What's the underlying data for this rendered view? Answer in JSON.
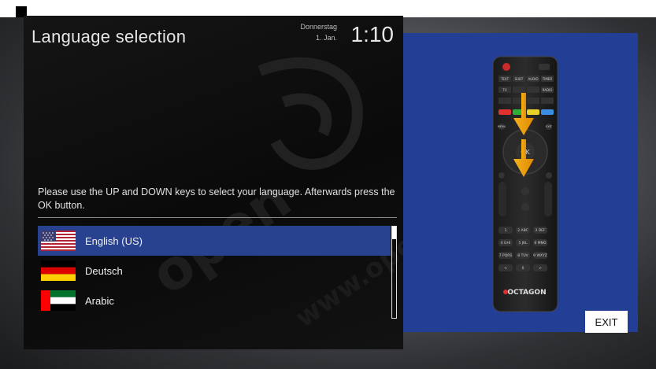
{
  "window": {
    "title": "Language selection",
    "day": "Donnerstag",
    "date": "1. Jan.",
    "time": "1:10"
  },
  "instructions": "Please use the UP and DOWN keys to select your language. Afterwards press the OK button.",
  "languages": [
    {
      "label": "English (US)",
      "flag": "us-flag-icon",
      "selected": true
    },
    {
      "label": "Deutsch",
      "flag": "germany-flag-icon",
      "selected": false
    },
    {
      "label": "Arabic",
      "flag": "uae-flag-icon",
      "selected": false
    }
  ],
  "remote": {
    "buttons": {
      "row1": [
        "TEXT",
        "SUBT",
        "AUDIO",
        "TIMER"
      ],
      "row2": [
        "TV",
        "RADIO"
      ],
      "menu": "MENU",
      "exit": "EXIT",
      "ok": "OK",
      "epg": "EPG",
      "pvr": "PVR",
      "volume": "VOLUME",
      "channel": "CHANNEL",
      "info": "INFO",
      "fuhr": "FUHR",
      "keys": [
        "1",
        "2 ABC",
        "3 DEF",
        "4 GHI",
        "5 JKL",
        "6 MNO",
        "7 PQRS",
        "8 TUV",
        "9 WXYZ",
        "<",
        "0",
        ">"
      ]
    },
    "brand": "OCTAGON",
    "hint": "down-arrow-icon"
  },
  "exit_label": "EXIT",
  "colors": {
    "selection": "#28428f",
    "right_panel": "#233f95",
    "arrow": "#f2a20a",
    "remote_red": "#e03030",
    "remote_green": "#2fae3a",
    "remote_yellow": "#e8d22a",
    "remote_blue": "#3a8de0"
  }
}
